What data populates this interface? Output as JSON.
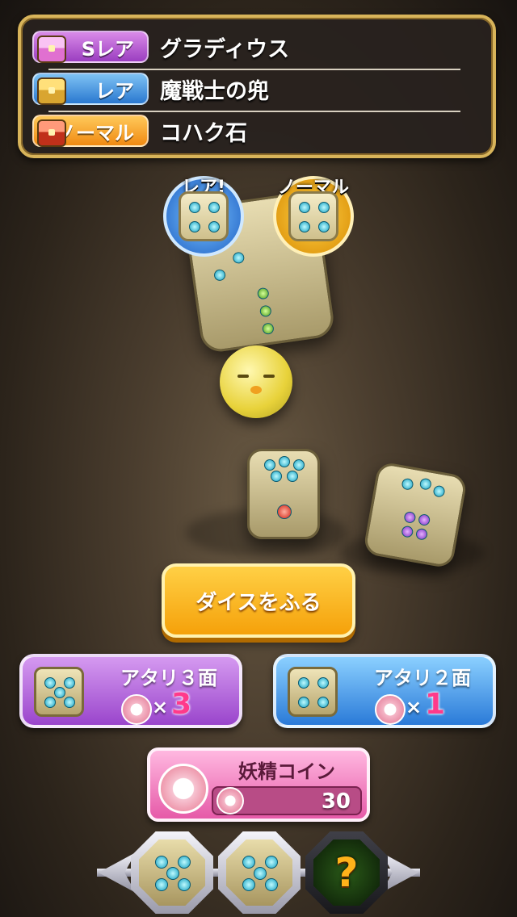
{
  "rewards": [
    {
      "rarity_label": "Sレア",
      "item_name": "グラディウス"
    },
    {
      "rarity_label": "レア",
      "item_name": "魔戦士の兜"
    },
    {
      "rarity_label": "ノーマル",
      "item_name": "コハク石"
    }
  ],
  "dice_badges": {
    "rare_label": "レア!",
    "normal_label": "ノーマル"
  },
  "roll_button_label": "ダイスをふる",
  "options": [
    {
      "title": "アタリ３面",
      "times": "×",
      "cost": "3"
    },
    {
      "title": "アタリ２面",
      "times": "×",
      "cost": "1"
    }
  ],
  "coin": {
    "title": "妖精コイン",
    "amount": "30"
  },
  "bottom_slots": {
    "unknown_symbol": "?"
  },
  "colors": {
    "sr_tag": "#b053d6",
    "rare_tag": "#3a8ae0",
    "normal_tag": "#f5a020",
    "roll_button": "#f8b21a",
    "cost_text": "#ff3a8a"
  }
}
